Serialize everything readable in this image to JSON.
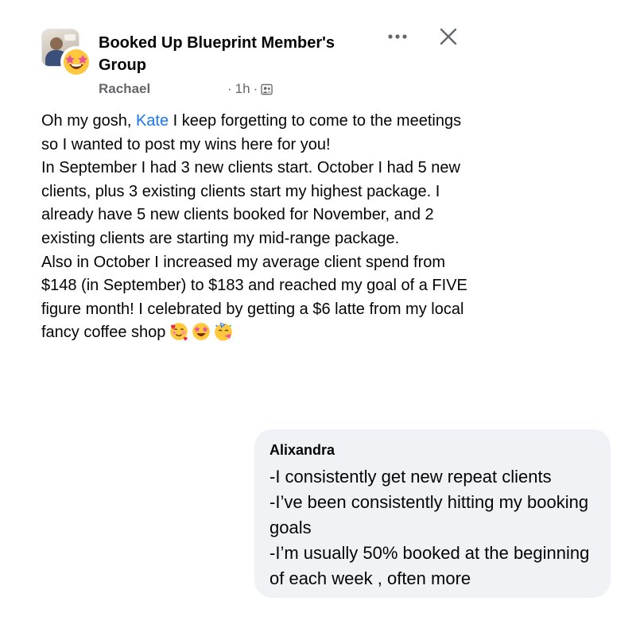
{
  "post": {
    "group_name": "Booked Up Blueprint Member's Group",
    "author": "Rachael",
    "timestamp": "1h",
    "separator": "·",
    "privacy_icon": "members-group-icon",
    "avatar_icons": [
      "group-photo",
      "star-struck-emoji"
    ],
    "body": {
      "intro_prefix": "Oh my gosh, ",
      "mention": "Kate",
      "intro_suffix": " I keep forgetting to come to the meetings so I wanted to post my wins here for you!",
      "paragraph_2": "In September I had 3 new clients start. October I had 5 new clients, plus 3 existing clients start my highest package. I already have 5 new clients booked for November, and 2 existing clients are starting my mid-range package.",
      "paragraph_3": "Also in October I increased my average client spend from $148 (in September) to $183 and reached my goal of a FIVE figure month! I celebrated by getting a $6 latte from my local fancy coffee shop",
      "emojis": [
        "smiling-face-with-hearts",
        "star-struck",
        "partying-face"
      ]
    }
  },
  "toolbar": {
    "more_icon": "more-options-icon",
    "close_icon": "close-icon"
  },
  "comment": {
    "author": "Alixandra",
    "lines": [
      "-I consistently get new repeat clients",
      "-I’ve been consistently hitting my booking goals",
      "-I’m usually 50% booked at the beginning of each week , often more"
    ]
  },
  "colors": {
    "mention": "#1877f2",
    "secondary_text": "#65676b",
    "comment_bg": "#f0f2f5"
  }
}
